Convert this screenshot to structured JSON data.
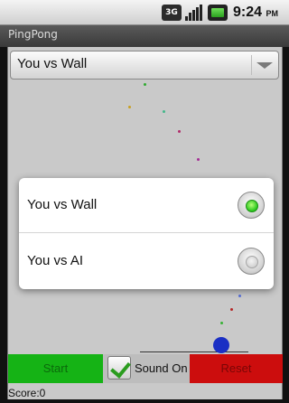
{
  "status_bar": {
    "network": "3G",
    "time": "9:24",
    "ampm": "PM",
    "icons": [
      "3g-icon",
      "signal-icon",
      "battery-icon"
    ]
  },
  "app": {
    "title": "PingPong"
  },
  "mode_spinner": {
    "selected": "You vs Wall"
  },
  "controls": {
    "start_label": "Start",
    "sound_label": "Sound On",
    "sound_checked": true,
    "reset_label": "Reset",
    "score": "Score:0"
  },
  "dialog": {
    "options": [
      {
        "label": "You vs Wall",
        "selected": true
      },
      {
        "label": "You vs AI",
        "selected": false
      }
    ]
  },
  "colors": {
    "start": "#15b315",
    "reset": "#cc0d0d",
    "ball": "#1a2fc4",
    "radio_on": "#25c51a"
  }
}
